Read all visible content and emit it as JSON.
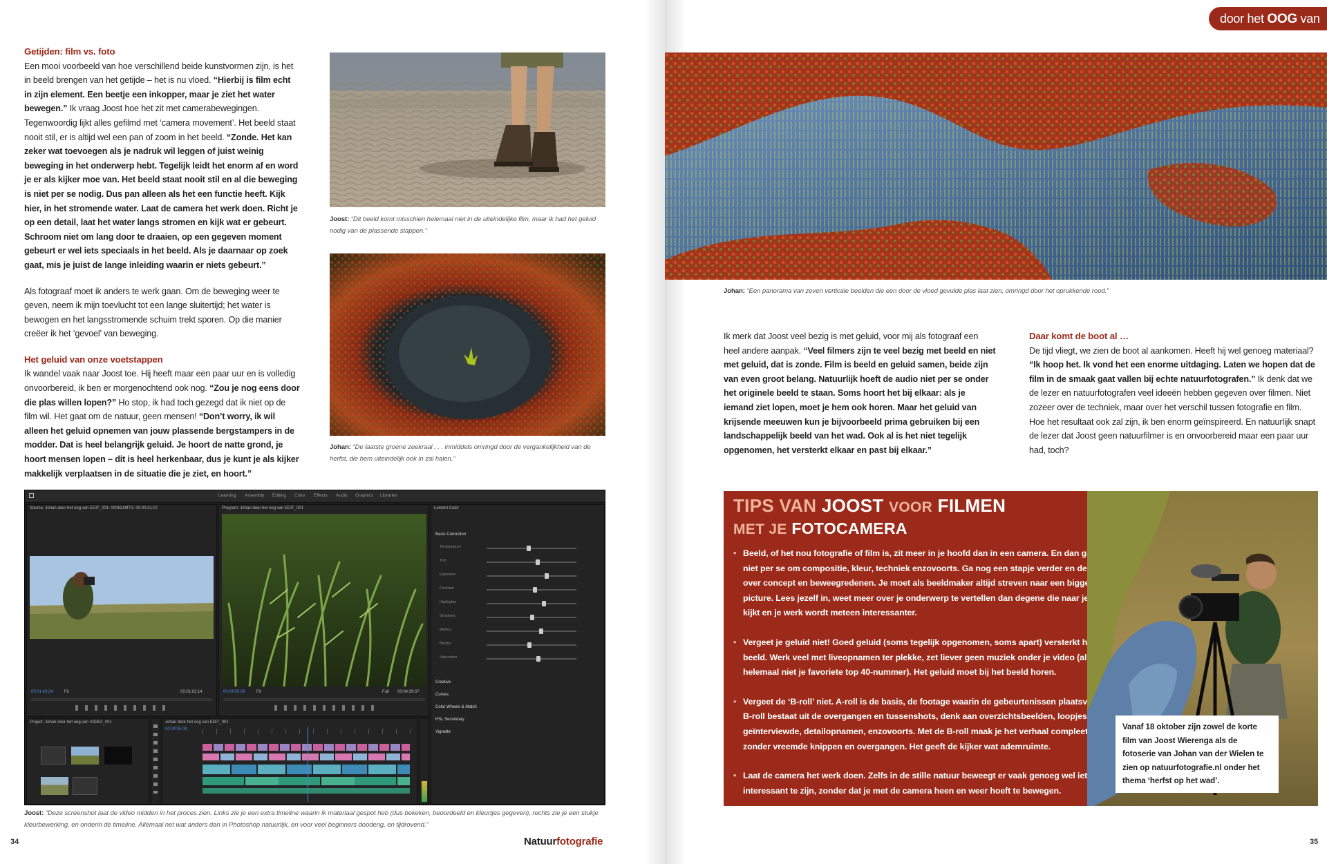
{
  "header": {
    "tab_prefix": "door het",
    "tab_bold": "OOG",
    "tab_suffix": "van"
  },
  "left_col": {
    "heading1": "Getijden: film vs. foto",
    "p1_intro": "Een mooi voorbeeld van hoe verschillend beide kunstvormen zijn, is het in beeld brengen van het getijde – het is nu vloed. ",
    "p1_quote": "“Hierbij is film echt in zijn element. Een beetje een inkopper, maar je ziet het water bewegen.”",
    "p1_mid": " Ik vraag Joost hoe het zit met camerabewegingen. Tegenwoordig lijkt alles gefilmd met ‘camera movement’. Het beeld staat nooit stil, er is altijd wel een pan of zoom in het beeld. ",
    "p1_quote2": "“Zonde. Het kan zeker wat toevoegen als je nadruk wil leggen of juist weinig beweging in het onderwerp hebt. Tegelijk leidt het enorm af en word je er als kijker moe van. Het beeld staat nooit stil en al die beweging is niet per se nodig. Dus pan alleen als het een functie heeft. Kijk hier, in het stromende water. Laat de camera het werk doen. Richt je op een detail, laat het water langs stromen en kijk wat er gebeurt. Schroom niet om lang door te draaien, op een gegeven moment gebeurt er wel iets speciaals in het beeld. Als je daarnaar op zoek gaat, mis je juist de lange inleiding waarin er niets gebeurt.”",
    "p2": "Als fotograaf moet ik anders te werk gaan. Om de beweging weer te geven, neem ik mijn toevlucht tot een lange sluitertijd; het water is bewogen en het langsstromende schuim trekt sporen. Op die manier creëer ik het ‘gevoel’ van beweging.",
    "heading2": "Het geluid van onze voetstappen",
    "p3_intro": "Ik wandel vaak naar Joost toe. Hij heeft maar een paar uur en is volledig onvoorbereid, ik ben er morgenochtend ook nog. ",
    "p3_quote": "“Zou je nog eens door die plas willen lopen?”",
    "p3_mid": " Ho stop, ik had toch gezegd dat ik niet op de film wil. Het gaat om de natuur, geen mensen! ",
    "p3_quote2": "“Don’t worry, ik wil alleen het geluid opnemen van jouw plassende bergstampers in de modder. Dat is heel belangrijk geluid. Je hoort de natte grond, je hoort mensen lopen – dit is heel herkenbaar, dus je kunt je als kijker makkelijk verplaatsen in de situatie die je ziet, en hoort.”"
  },
  "captions": {
    "boots_name": "Joost:",
    "boots_text": " “Dit beeld komt misschien helemaal niet in de uiteindelijke film, maar ik had het geluid nodig van de plassende stappen.”",
    "pool_name": "Johan:",
    "pool_text": " “De laatste groene zeekraal . . . inmiddels omringd door de vergankelijkheid van de herfst, die hem uiteindelijk ook in zal halen.”",
    "editor_name": "Joost:",
    "editor_text": " “Deze screenshot laat de video midden in het proces zien. Links zie je een extra timeline waarin ik materiaal gespot heb (dus bekeken, beoordeeld en kleurtjes gegeven), rechts zie je een stukje kleurbewerking, en onderin de timeline. Allemaal net wat anders dan in Photoshop natuurlijk, en voor veel beginners doodeng, en tijdrovend.”",
    "panorama_name": "Johan:",
    "panorama_text": " “Een panorama van zeven verticale beelden die een door de vloed gevulde plas laat zien, omringd door het oprukkende rood.”"
  },
  "mid_col": {
    "intro": "Ik merk dat Joost veel bezig is met geluid, voor mij als fotograaf een heel andere aanpak. ",
    "quote": "“Veel filmers zijn te veel bezig met beeld en niet met geluid, dat is zonde. Film is beeld en geluid samen, beide zijn van even groot belang. Natuurlijk hoeft de audio niet per se onder het originele beeld te staan. Soms hoort het bij elkaar: als je iemand ziet lopen, moet je hem ook horen. Maar het geluid van krijsende meeuwen kun je bijvoorbeeld prima gebruiken bij een landschappelijk beeld van het wad. Ook al is het niet tegelijk opgenomen, het versterkt elkaar en past bij elkaar.”"
  },
  "right_col": {
    "heading": "Daar komt de boot al …",
    "intro": "De tijd vliegt, we zien de boot al aankomen. Heeft hij wel genoeg materiaal? ",
    "quote": "“Ik hoop het. Ik vond het een enorme uitdaging. Laten we hopen dat de film in de smaak gaat vallen bij echte natuurfotografen.”",
    "rest": " Ik denk dat we de lezer en natuurfotografen veel ideeën hebben gegeven over filmen. Niet zozeer over de techniek, maar over het verschil tussen fotografie en film. Hoe het resultaat ook zal zijn, ik ben enorm geïnspireerd. En natuurlijk snapt de lezer dat Joost geen natuurfilmer is en onvoorbereid maar een paar uur had, toch?"
  },
  "tips": {
    "title_w1": "Tips van",
    "title_w2": "Joost",
    "title_w3": "voor",
    "title_w4": "filmen",
    "title_w5": "met je",
    "title_w6": "fotocamera",
    "items": [
      "Beeld, of het nou fotografie of film is, zit meer in je hoofd dan in een camera. En dan gaat het niet per se om compositie, kleur, techniek enzovoorts. Ga nog een stapje verder en denk na over concept en beweegredenen. Je moet als beeldmaker altijd streven naar een bigger picture. Lees jezelf in, weet meer over je onderwerp te vertellen dan degene die naar je beeld kijkt en je werk wordt meteen interessanter.",
      "Vergeet je geluid niet! Goed geluid (soms tegelijk opgenomen, soms apart) versterkt het beeld. Werk veel met liveopnamen ter plekke, zet liever geen muziek onder je video (al helemaal niet je favoriete top 40-nummer). Het geluid moet bij het beeld horen.",
      "Vergeet de ‘B-roll’ niet. A-roll is de basis, de footage waarin de gebeurtenissen plaatsvinden. B-roll bestaat uit de overgangen en tussenshots, denk aan overzichtsbeelden, loopjes van de geïnterviewde, detailopnamen, enzovoorts. Met de B-roll maak je het verhaal compleet zonder vreemde knippen en overgangen. Het geeft de kijker wat ademruimte.",
      "Laat de camera het werk doen. Zelfs in de stille natuur beweegt er vaak genoeg wel iets om interessant te zijn, zonder dat je met de camera heen en weer hoeft te bewegen."
    ]
  },
  "callout": "Vanaf 18 oktober zijn zowel de korte film van Joost Wierenga als de fotoserie van Johan van der Wielen te zien op natuurfotografie.nl onder het thema ‘herfst op het wad’.",
  "footer": {
    "left_page_number": "34",
    "right_page_number": "35",
    "brand_part1": "Natuur",
    "brand_part2": "fotografie"
  },
  "editor": {
    "workspaces": [
      "Learning",
      "Assembly",
      "Editing",
      "Color",
      "Effects",
      "Audio",
      "Graphics",
      "Libraries"
    ],
    "source_label": "Source: Johan door het oog van EDIT_001: 000631MTS: 00:00:31:07",
    "program_label": "Program: Johan door het oog van EDIT_001",
    "lumetri_label": "Lumetri Color",
    "source_timecode": "00:01:43:24",
    "source_duration": "00:01:02:14",
    "program_timecode": "00:04:05:09",
    "program_duration": "00:04:39:07",
    "fit_label": "Fit",
    "full_label": "Full",
    "project_label": "Project: Johan door het oog van VIDEO_001",
    "timeline_label": "Johan door het oog van EDIT_001",
    "timeline_timecode": "00:04:05:09",
    "lumetri_sections": [
      "Basic Correction",
      "Creative",
      "Curves",
      "Color Wheels & Match",
      "HSL Secondary",
      "Vignette"
    ],
    "lumetri_rows": [
      "Temperature",
      "Tint",
      "Exposure",
      "Contrast",
      "Highlights",
      "Shadows",
      "Whites",
      "Blacks",
      "Saturation"
    ]
  },
  "colors": {
    "accent_red": "#9b2a1a",
    "tips_pale": "#f0b39c"
  }
}
